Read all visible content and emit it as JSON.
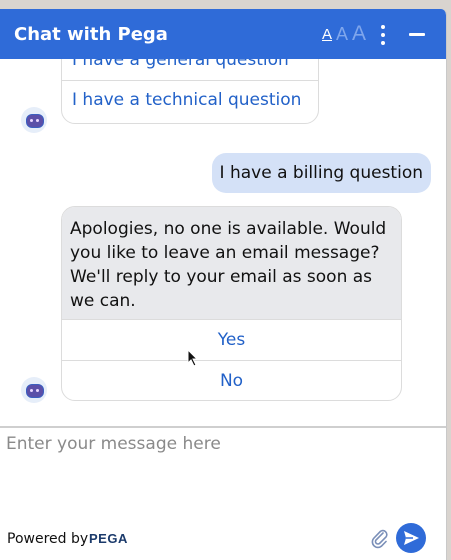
{
  "header": {
    "title": "Chat with Pega",
    "font_size_small": "A",
    "font_size_medium": "A",
    "font_size_large": "A"
  },
  "messages": {
    "options_top": [
      "I have a general question",
      "I have a technical question"
    ],
    "user_message": "I have a billing question",
    "bot_message": "Apologies, no one is available. Would you like to leave an email message? We'll reply to your email as soon as we can.",
    "bot_buttons": [
      "Yes",
      "No"
    ]
  },
  "composer": {
    "placeholder": "Enter your message here"
  },
  "footer": {
    "powered_by": "Powered by",
    "brand": "PEGA"
  },
  "colors": {
    "accent": "#2f6bd8",
    "user_bubble": "#d4e1f7",
    "bot_bubble": "#e8e9ec",
    "link": "#2261c8"
  },
  "icons": {
    "menu": "kebab-icon",
    "minimize": "minimize-icon",
    "attach": "paperclip-icon",
    "send": "send-icon",
    "bot": "bot-avatar-icon"
  }
}
